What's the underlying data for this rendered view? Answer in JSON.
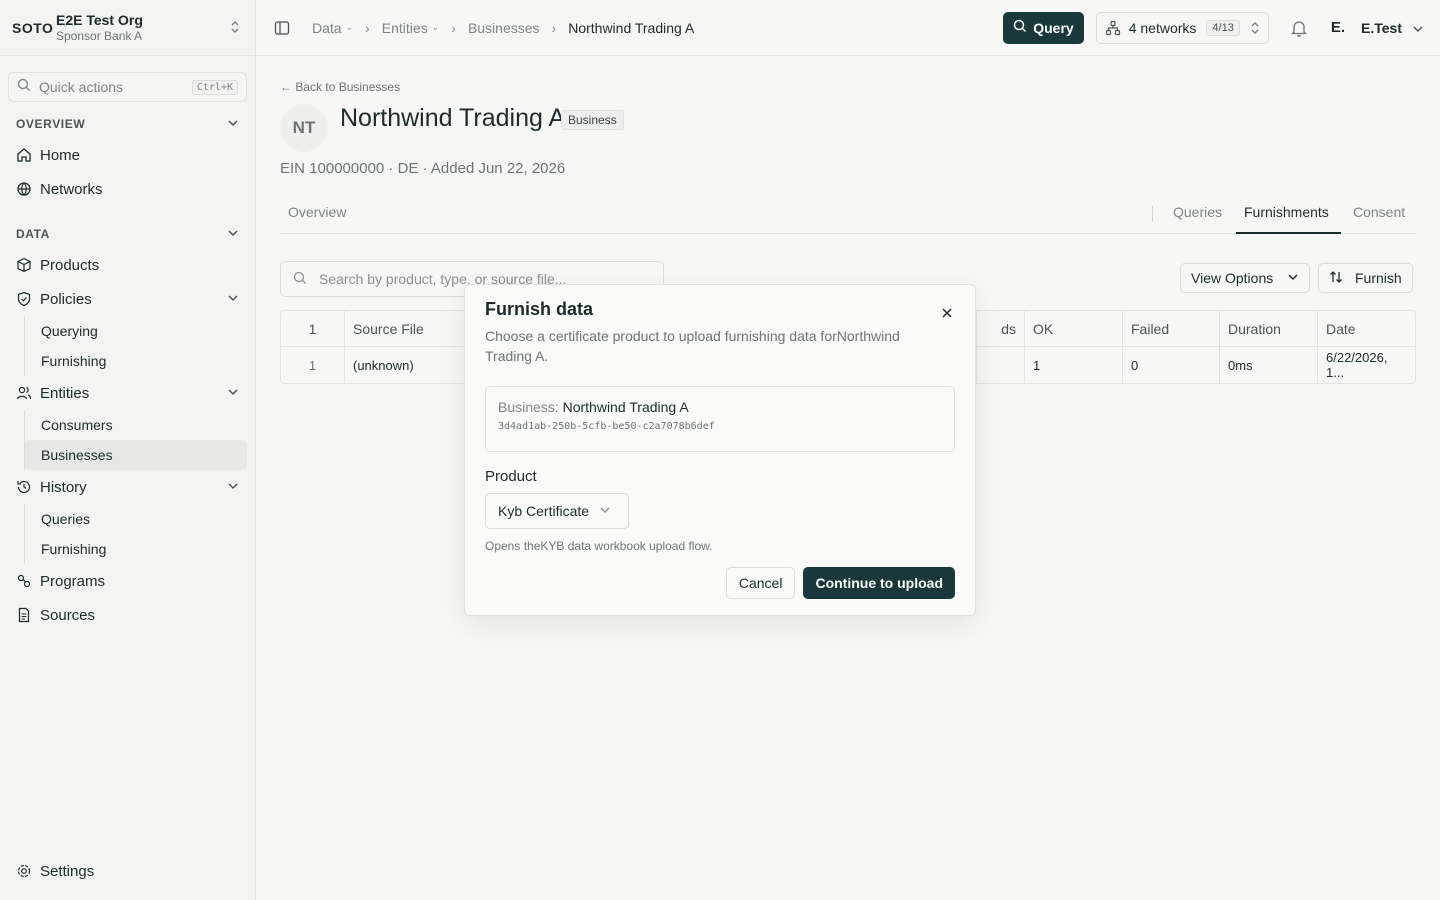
{
  "org": {
    "logo": "SOTO",
    "name": "E2E Test Org",
    "sub": "Sponsor Bank A"
  },
  "quick_actions": {
    "label": "Quick actions",
    "shortcut": "Ctrl+K"
  },
  "sidebar": {
    "overview_label": "OVERVIEW",
    "home": "Home",
    "networks": "Networks",
    "data_label": "DATA",
    "products": "Products",
    "policies": "Policies",
    "policies_sub": [
      "Querying",
      "Furnishing"
    ],
    "entities": "Entities",
    "entities_sub": [
      "Consumers",
      "Businesses"
    ],
    "history": "History",
    "history_sub": [
      "Queries",
      "Furnishing"
    ],
    "programs": "Programs",
    "sources": "Sources",
    "settings": "Settings"
  },
  "breadcrumb": {
    "data": "Data",
    "entities": "Entities",
    "businesses": "Businesses",
    "current": "Northwind Trading A"
  },
  "topbar": {
    "query": "Query",
    "networks": "4 networks",
    "networks_badge": "4/13",
    "user_initial": "E.",
    "user_name": "E.Test"
  },
  "entity": {
    "back": "Back to Businesses",
    "avatar": "NT",
    "title": "Northwind Trading A",
    "badge": "Business",
    "meta": "EIN 100000000 · DE · Added Jun 22, 2026"
  },
  "tabs": {
    "overview": "Overview",
    "queries": "Queries",
    "furnishments": "Furnishments",
    "consent": "Consent"
  },
  "toolbar": {
    "search_placeholder": "Search by product, type, or source file...",
    "view_options": "View Options",
    "furnish": "Furnish"
  },
  "table": {
    "headers": [
      "1",
      "Source File",
      "ds",
      "OK",
      "Failed",
      "Duration",
      "Date"
    ],
    "row": [
      "1",
      "(unknown)",
      "",
      "1",
      "0",
      "0ms",
      "6/22/2026, 1..."
    ]
  },
  "dialog": {
    "title": "Furnish data",
    "description": "Choose a certificate product to upload furnishing data forNorthwind Trading A.",
    "entity_key": "Business:",
    "entity_value": "Northwind Trading A",
    "entity_id": "3d4ad1ab-250b-5cfb-be50-c2a7078b6def",
    "product_label": "Product",
    "product_value": "Kyb Certificate",
    "hint": "Opens theKYB data workbook upload flow.",
    "cancel": "Cancel",
    "continue": "Continue to upload"
  }
}
